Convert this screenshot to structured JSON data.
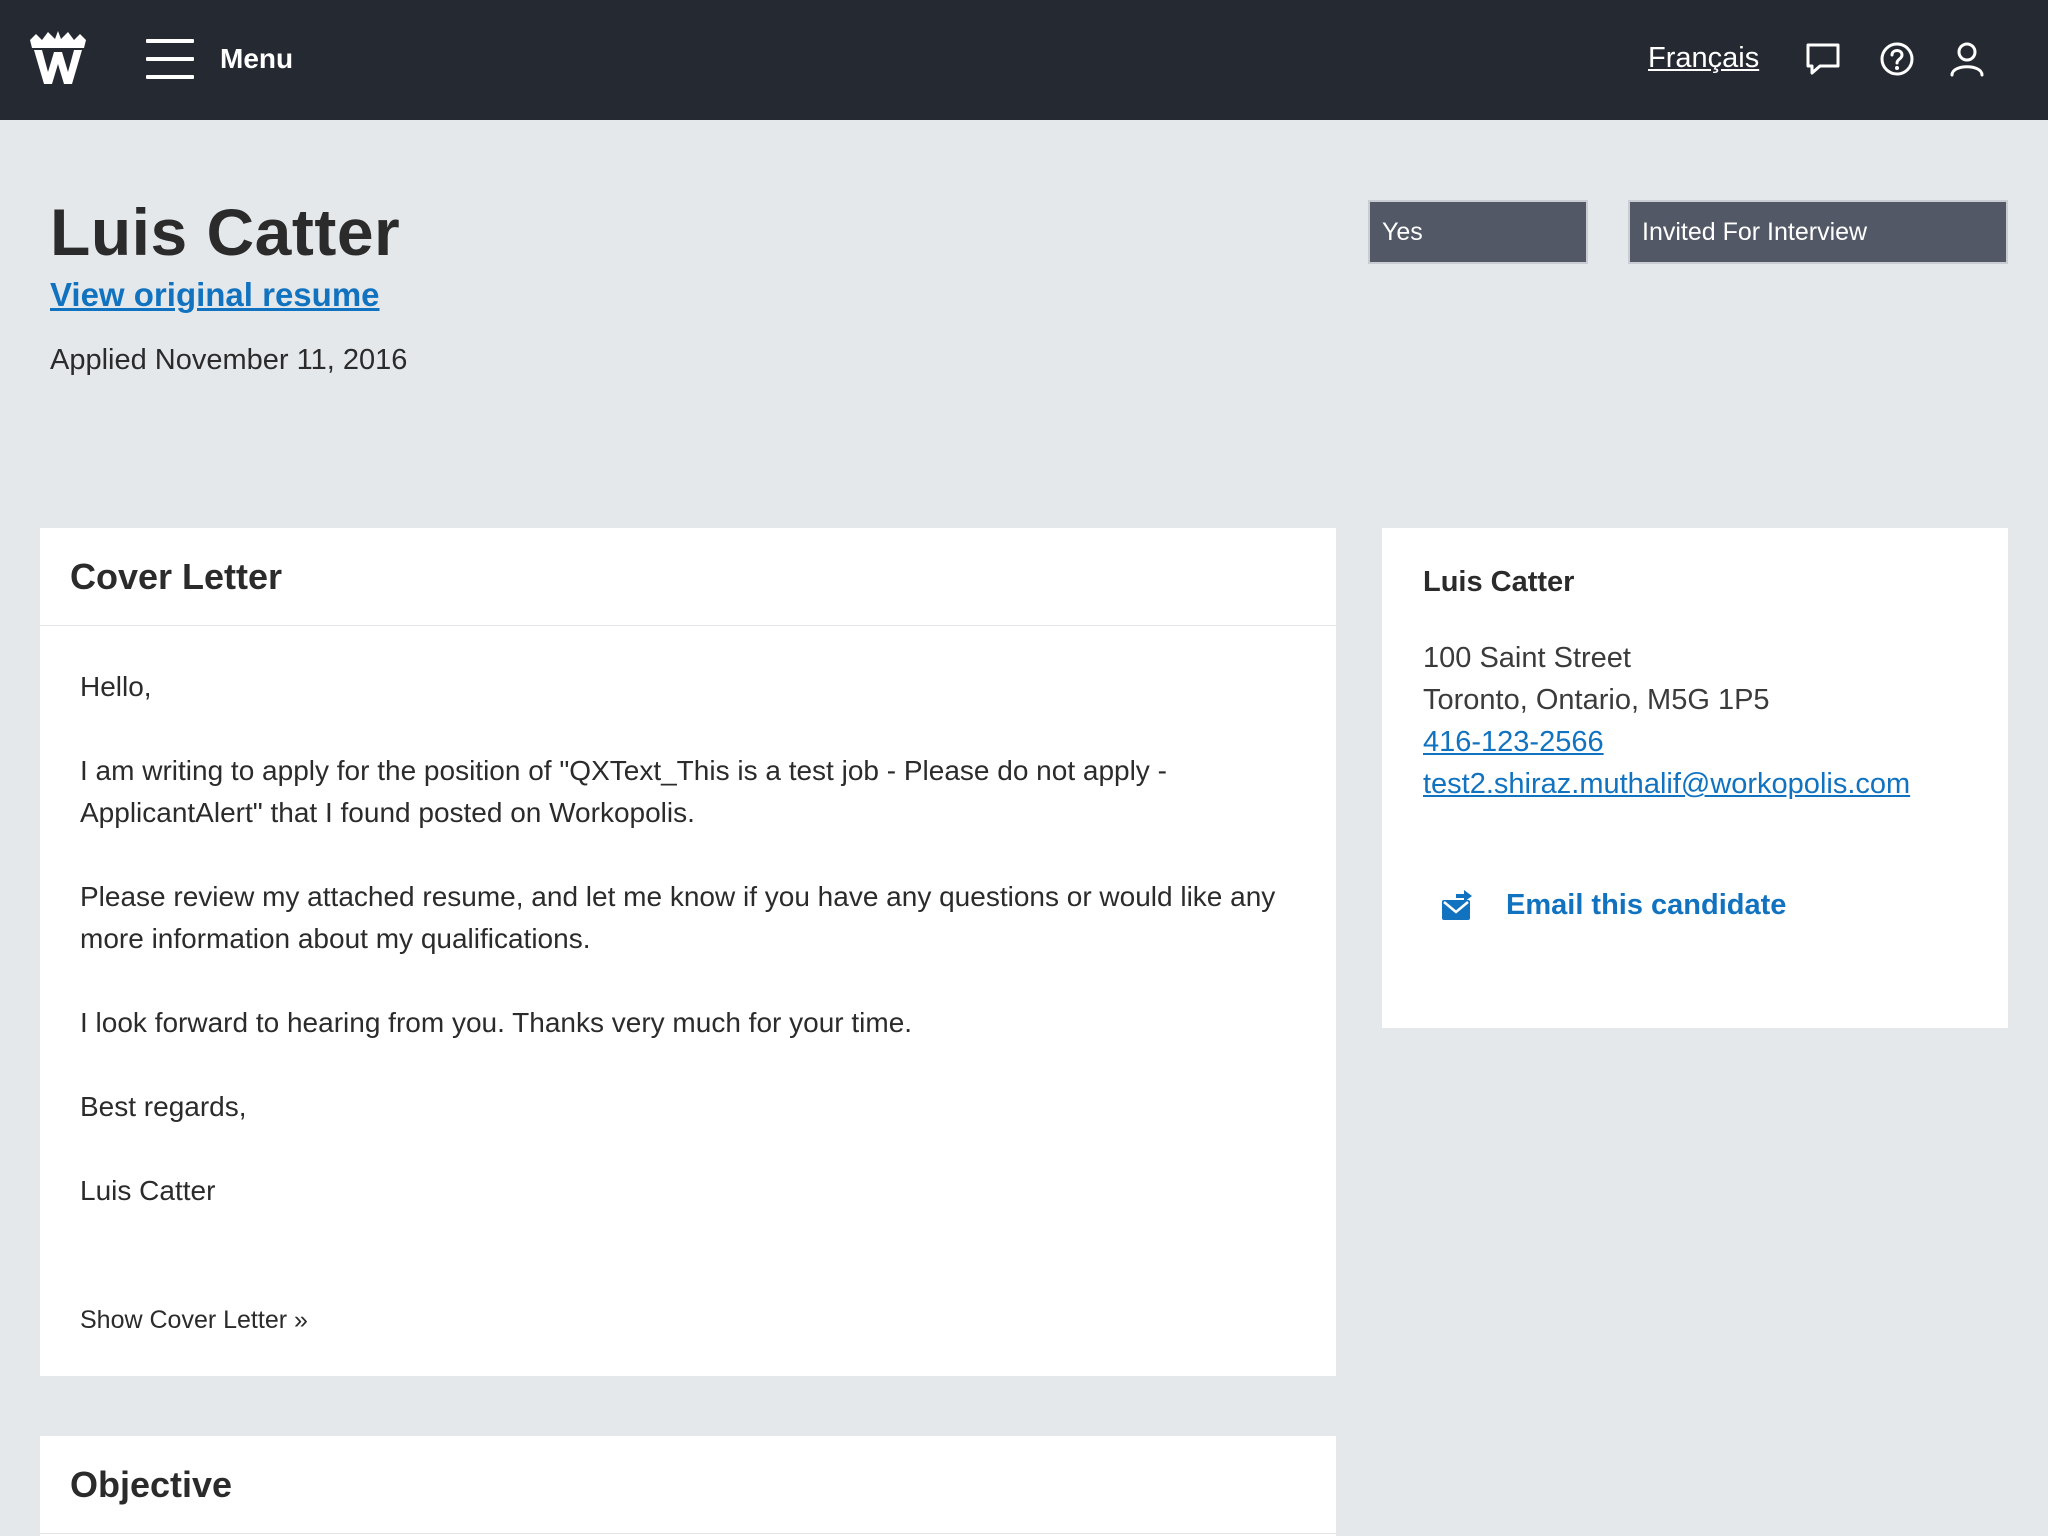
{
  "header": {
    "logo_icon": "workopolis-logo-icon",
    "menu_label": "Menu",
    "language_link": "Français",
    "icons": [
      "chat-icon",
      "help-icon",
      "user-icon"
    ]
  },
  "candidate": {
    "name": "Luis Catter",
    "view_resume": "View original resume",
    "applied": "Applied November 11, 2016"
  },
  "status": {
    "interest_value": "Yes",
    "stage_value": "Invited For Interview"
  },
  "cover_letter": {
    "title": "Cover Letter",
    "paragraphs": [
      "Hello,",
      "I am writing to apply for the position of \"QXText_This is a test job - Please do not apply - ApplicantAlert\" that I found posted on Workopolis.",
      "Please review my attached resume, and let me know if you have any questions or would like any more information about my qualifications.",
      "I look forward to hearing from you. Thanks very much for your time.",
      "Best regards,",
      "Luis Catter"
    ],
    "show_link": "Show Cover Letter »"
  },
  "objective": {
    "title": "Objective"
  },
  "contact": {
    "name": "Luis Catter",
    "street": "100 Saint Street",
    "city_line": "Toronto, Ontario, M5G 1P5",
    "phone": "416-123-2566",
    "email": "test2.shiraz.muthalif@workopolis.com",
    "email_action": "Email this candidate",
    "email_action_icon": "envelope-arrow-icon"
  },
  "colors": {
    "topbar": "#252932",
    "page_bg": "#e5e8eb",
    "link": "#1173c0",
    "select_bg": "#525866"
  }
}
